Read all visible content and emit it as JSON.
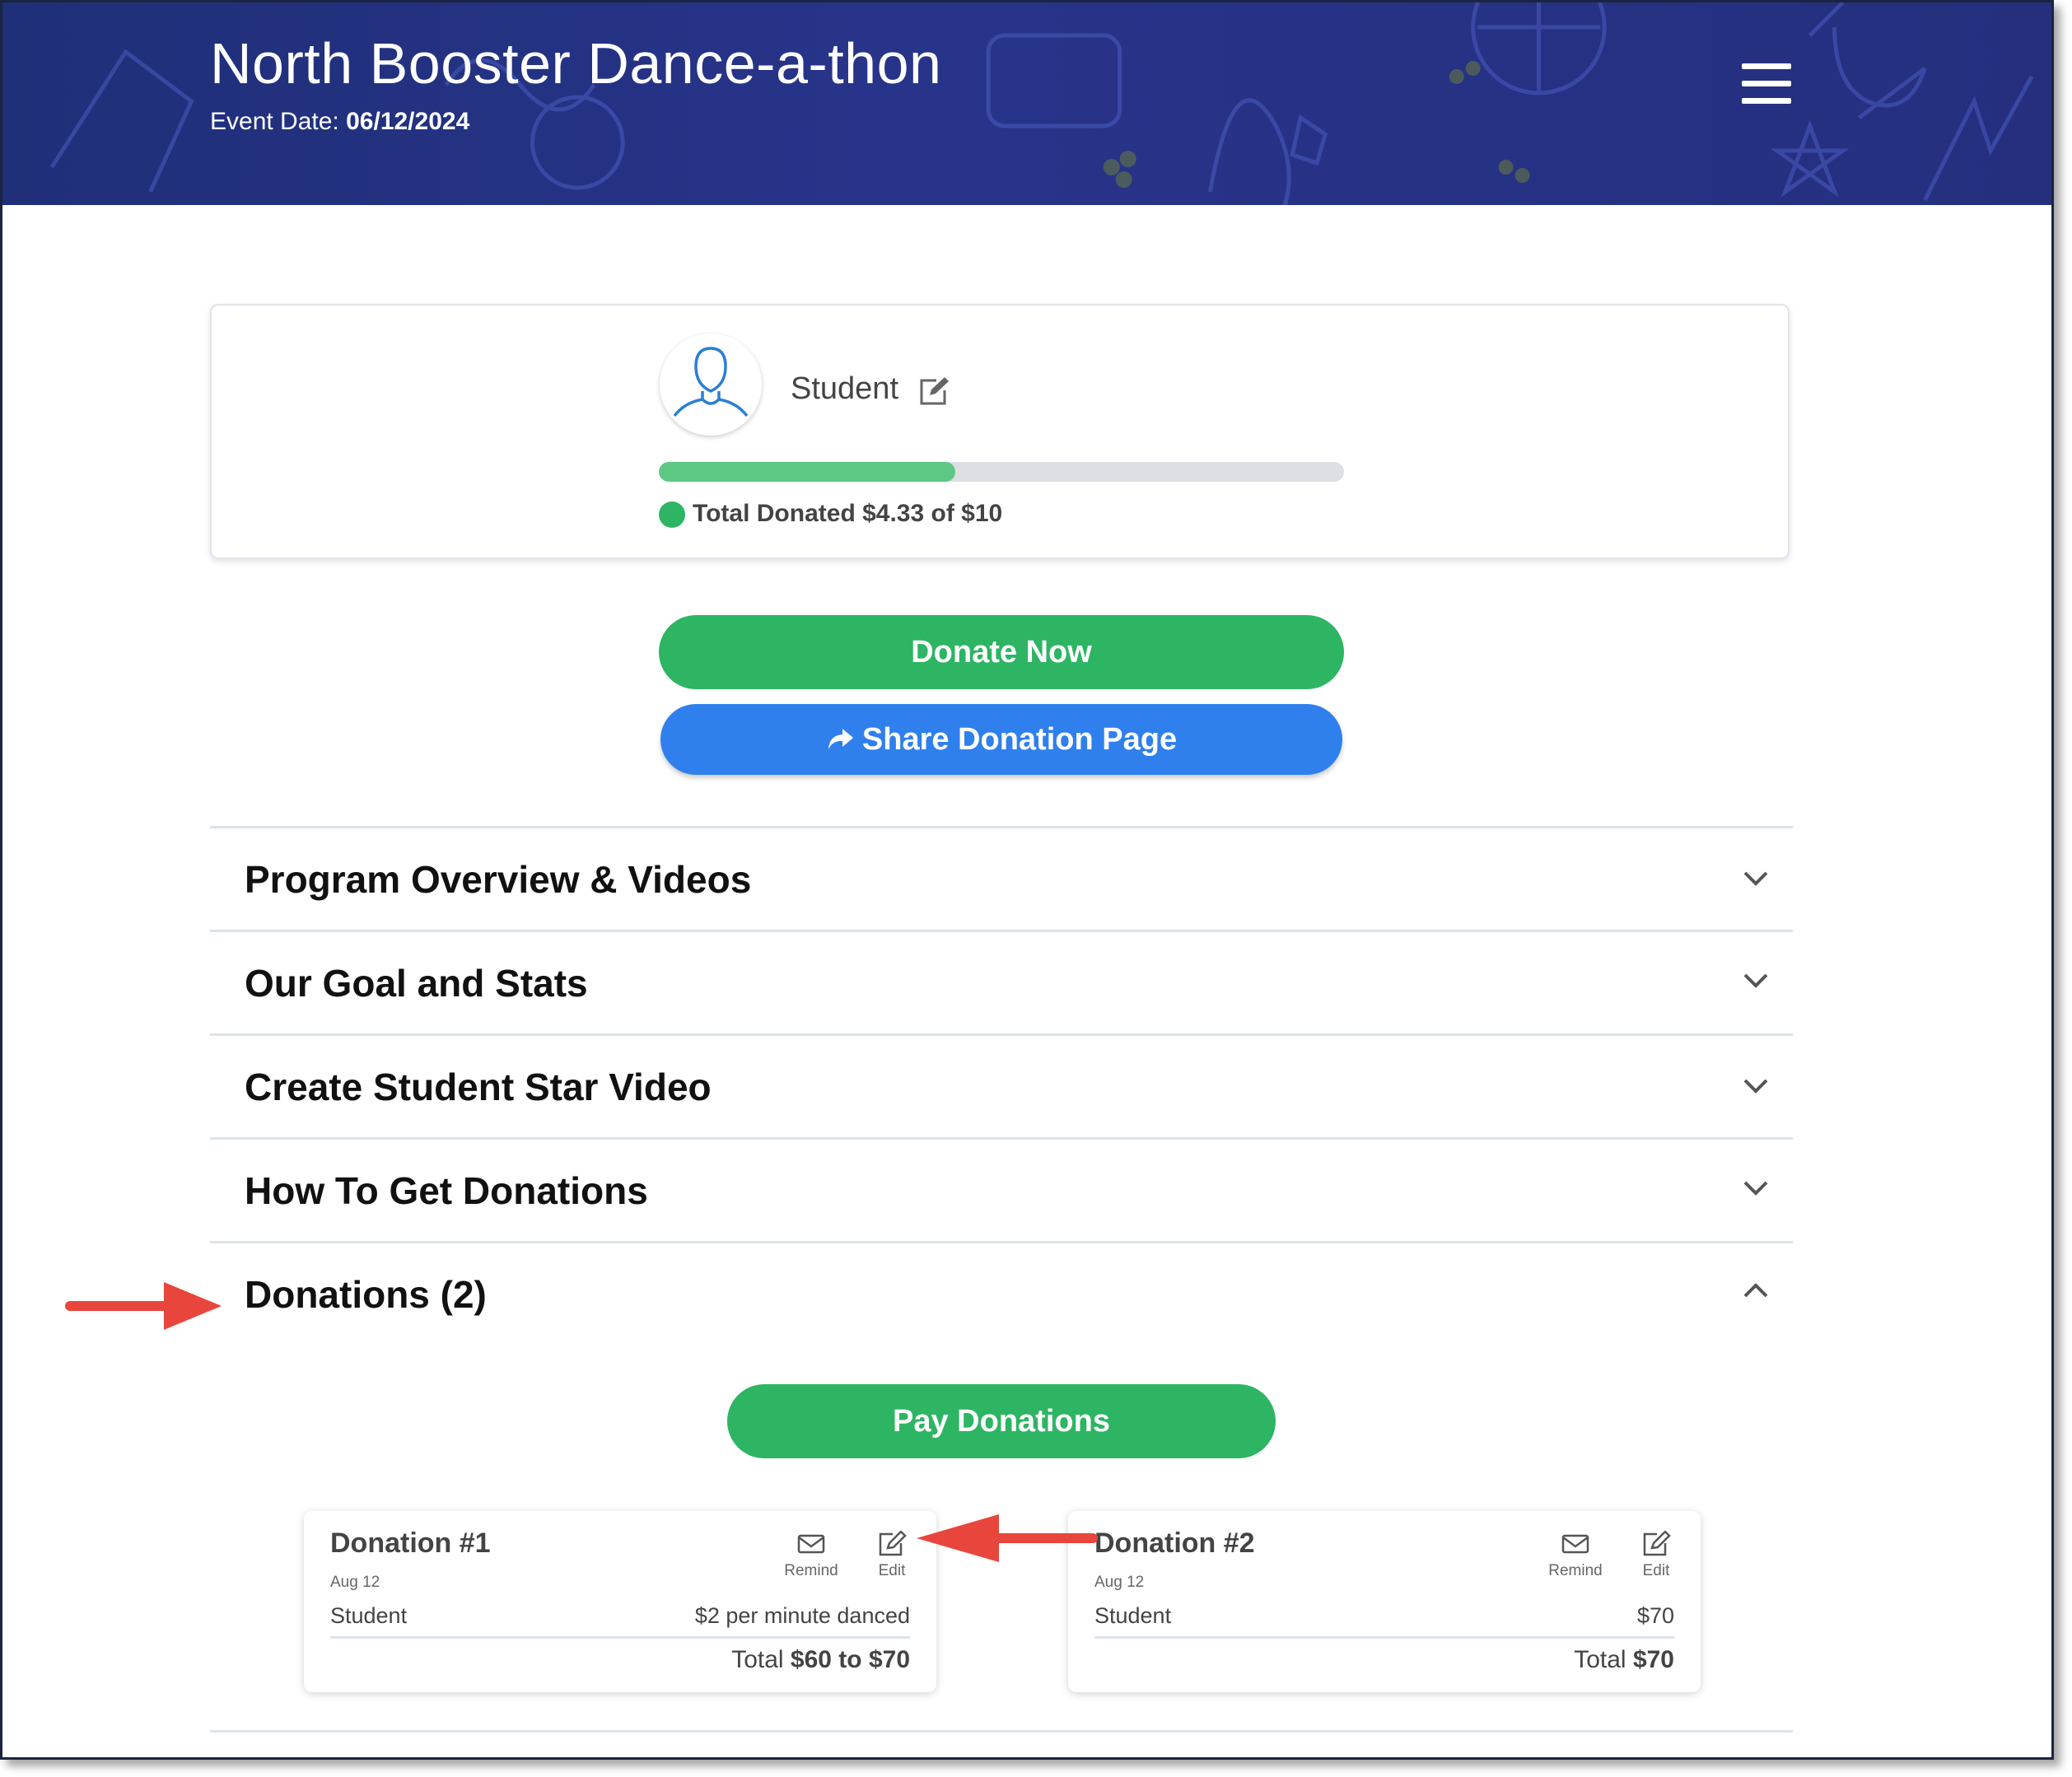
{
  "header": {
    "title": "North Booster Dance-a-thon",
    "event_date_label": "Event Date:",
    "event_date": "06/12/2024"
  },
  "profile": {
    "name": "Student",
    "progress_fraction": 0.433,
    "total_donated_text": "Total Donated $4.33 of $10"
  },
  "buttons": {
    "donate_now": "Donate Now",
    "share": "Share Donation Page",
    "pay_donations": "Pay Donations"
  },
  "accordion": [
    {
      "label": "Program Overview & Videos",
      "expanded": false
    },
    {
      "label": "Our Goal and Stats",
      "expanded": false
    },
    {
      "label": "Create Student Star Video",
      "expanded": false
    },
    {
      "label": "How To Get Donations",
      "expanded": false
    },
    {
      "label": "Donations (2)",
      "expanded": true
    }
  ],
  "donations": [
    {
      "title": "Donation #1",
      "date": "Aug 12",
      "remind_label": "Remind",
      "edit_label": "Edit",
      "name": "Student",
      "pledge": "$2 per minute danced",
      "total_label": "Total",
      "total_value": "$60 to $70"
    },
    {
      "title": "Donation #2",
      "date": "Aug 12",
      "remind_label": "Remind",
      "edit_label": "Edit",
      "name": "Student",
      "pledge": "$70",
      "total_label": "Total",
      "total_value": "$70"
    }
  ],
  "colors": {
    "header_bg": "#252f7e",
    "green": "#2db563",
    "blue": "#2f80ed",
    "annotation_arrow": "#e8463c"
  }
}
